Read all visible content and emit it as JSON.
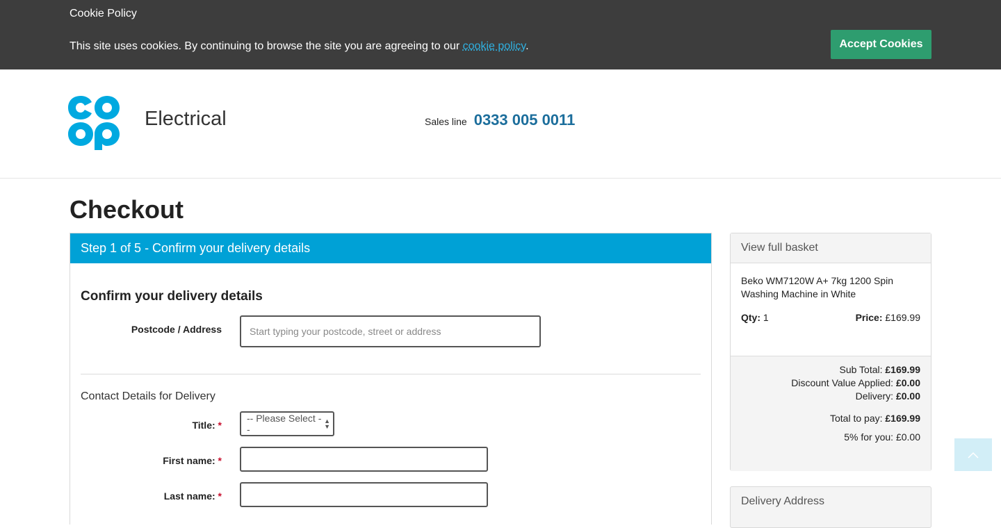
{
  "cookie_banner": {
    "title": "Cookie Policy",
    "message_before": "This site uses cookies. By continuing to browse the site you are agreeing to our ",
    "link_text": "cookie policy",
    "message_after": ".",
    "accept_label": "Accept Cookies"
  },
  "header": {
    "brand": "Electrical",
    "sales_label": "Sales line",
    "sales_number": "0333 005 0011"
  },
  "page": {
    "title": "Checkout"
  },
  "step": {
    "header": "Step 1 of 5 - Confirm your delivery details",
    "section_title": "Confirm your delivery details",
    "postcode_label": "Postcode / Address",
    "postcode_placeholder": "Start typing your postcode, street or address",
    "contact_title": "Contact Details for Delivery",
    "title_label": "Title:",
    "title_select": "-- Please Select --",
    "first_name_label": "First name:",
    "last_name_label": "Last name:",
    "required_mark": "*"
  },
  "basket": {
    "header": "View full basket",
    "product": "Beko WM7120W A+ 7kg 1200 Spin Washing Machine in White",
    "qty_label": "Qty:",
    "qty_value": "1",
    "price_label": "Price:",
    "price_value": "£169.99",
    "subtotal_label": "Sub Total:",
    "subtotal_value": "£169.99",
    "discount_label": "Discount Value Applied:",
    "discount_value": "£0.00",
    "delivery_label": "Delivery:",
    "delivery_value": "£0.00",
    "total_label": "Total to pay:",
    "total_value": "£169.99",
    "five_pct_label": "5% for you:",
    "five_pct_value": "£0.00"
  },
  "delivery_address": {
    "header": "Delivery Address"
  },
  "icons": {
    "logo": "coop-logo",
    "back_to_top": "chevron-up-icon"
  },
  "colors": {
    "brand_blue": "#00a1d6",
    "accept_green": "#2e9d6f",
    "phone_blue": "#1c6e9c",
    "banner_bg": "#3d3d3d"
  }
}
